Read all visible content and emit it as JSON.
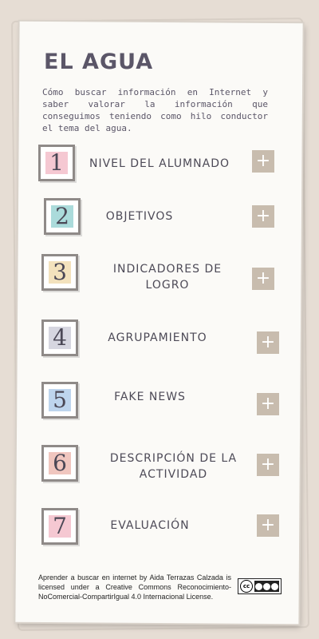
{
  "page": {
    "title": "EL AGUA",
    "subtitle": "Cómo buscar información en Internet y saber valorar la información que conseguimos teniendo como hilo conductor el tema del agua."
  },
  "sections": [
    {
      "number": "1",
      "label": "NIVEL DEL ALUMNADO",
      "color": "#f2b6c4"
    },
    {
      "number": "2",
      "label": "OBJETIVOS",
      "color": "#8fcfcf"
    },
    {
      "number": "3",
      "label": "INDICADORES DE LOGRO",
      "color": "#f0d9a8"
    },
    {
      "number": "4",
      "label": "AGRUPAMIENTO",
      "color": "#c9c9d6"
    },
    {
      "number": "5",
      "label": "FAKE NEWS",
      "color": "#a9c7e9"
    },
    {
      "number": "6",
      "label": "DESCRIPCIÓN DE LA ACTIVIDAD",
      "color": "#ecb3aa"
    },
    {
      "number": "7",
      "label": "EVALUACIÓN",
      "color": "#f2b6c4"
    }
  ],
  "expand_symbol": "+",
  "footer": {
    "license_text": "Aprender a buscar en internet by Aida Terrazas Calzada is licensed under a Creative Commons Reconocimiento-NoComercial-CompartirIgual 4.0 Internacional License.",
    "badge_cc": "cc",
    "icon": "creative-commons-badge"
  }
}
